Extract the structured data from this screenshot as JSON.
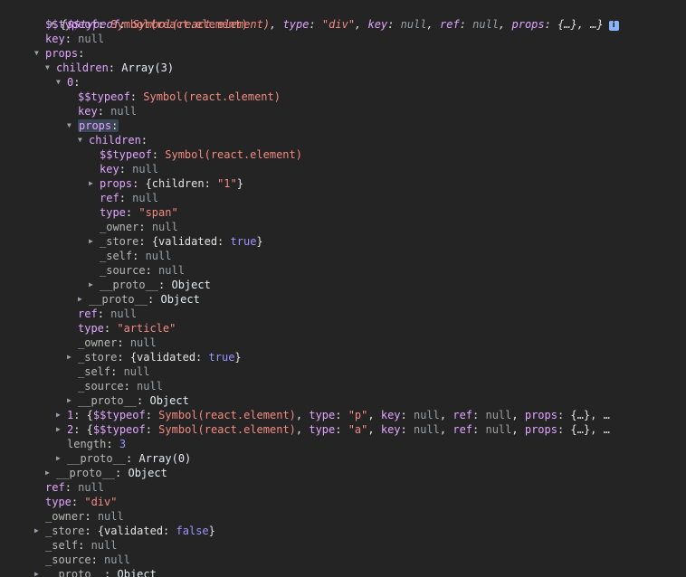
{
  "summary": {
    "typeof_key": "$$typeof",
    "typeof_val": "Symbol(react.element)",
    "type_key": "type",
    "type_val": "\"div\"",
    "key_key": "key",
    "key_val": "null",
    "ref_key": "ref",
    "ref_val": "null",
    "props_key": "props",
    "props_val": "{…}",
    "ellipsis": "…",
    "info_icon": "i"
  },
  "lines": {
    "l1_k": "$$typeof",
    "l1_v": "Symbol(react.element)",
    "l2_k": "key",
    "l2_v": "null",
    "l3_k": "props",
    "l4_k": "children",
    "l4_v": "Array(3)",
    "l5_k": "0",
    "l6_k": "$$typeof",
    "l6_v": "Symbol(react.element)",
    "l7_k": "key",
    "l7_v": "null",
    "l8_k": "props",
    "l9_k": "children",
    "l10_k": "$$typeof",
    "l10_v": "Symbol(react.element)",
    "l11_k": "key",
    "l11_v": "null",
    "l12_k": "props",
    "l12_v_open": "{children: ",
    "l12_v_str": "\"1\"",
    "l12_v_close": "}",
    "l13_k": "ref",
    "l13_v": "null",
    "l14_k": "type",
    "l14_v": "\"span\"",
    "l15_k": "_owner",
    "l15_v": "null",
    "l16_k": "_store",
    "l16_v_open": "{validated: ",
    "l16_v_bool": "true",
    "l16_v_close": "}",
    "l17_k": "_self",
    "l17_v": "null",
    "l18_k": "_source",
    "l18_v": "null",
    "l19_k": "__proto__",
    "l19_v": "Object",
    "l20_k": "__proto__",
    "l20_v": "Object",
    "l21_k": "ref",
    "l21_v": "null",
    "l22_k": "type",
    "l22_v": "\"article\"",
    "l23_k": "_owner",
    "l23_v": "null",
    "l24_k": "_store",
    "l24_v_open": "{validated: ",
    "l24_v_bool": "true",
    "l24_v_close": "}",
    "l25_k": "_self",
    "l25_v": "null",
    "l26_k": "_source",
    "l26_v": "null",
    "l27_k": "__proto__",
    "l27_v": "Object",
    "l28_k": "1",
    "l28_type": "\"p\"",
    "l29_k": "2",
    "l29_type": "\"a\"",
    "l30_k": "length",
    "l30_v": "3",
    "l31_k": "__proto__",
    "l31_v": "Array(0)",
    "l32_k": "__proto__",
    "l32_v": "Object",
    "l33_k": "ref",
    "l33_v": "null",
    "l34_k": "type",
    "l34_v": "\"div\"",
    "l35_k": "_owner",
    "l35_v": "null",
    "l36_k": "_store",
    "l36_v_open": "{validated: ",
    "l36_v_bool": "false",
    "l36_v_close": "}",
    "l37_k": "_self",
    "l37_v": "null",
    "l38_k": "_source",
    "l38_v": "null",
    "l39_k": "__proto__",
    "l39_v": "Object"
  },
  "row_summary": {
    "typeof_key": "$$typeof",
    "sym": "Symbol(react.element)",
    "type_key": "type",
    "key_key": "key",
    "null": "null",
    "ref_key": "ref",
    "props_key": "props",
    "props_val": "{…}",
    "ellipsis": "…"
  },
  "icons": {
    "expanded": "▼",
    "collapsed": "▶"
  }
}
